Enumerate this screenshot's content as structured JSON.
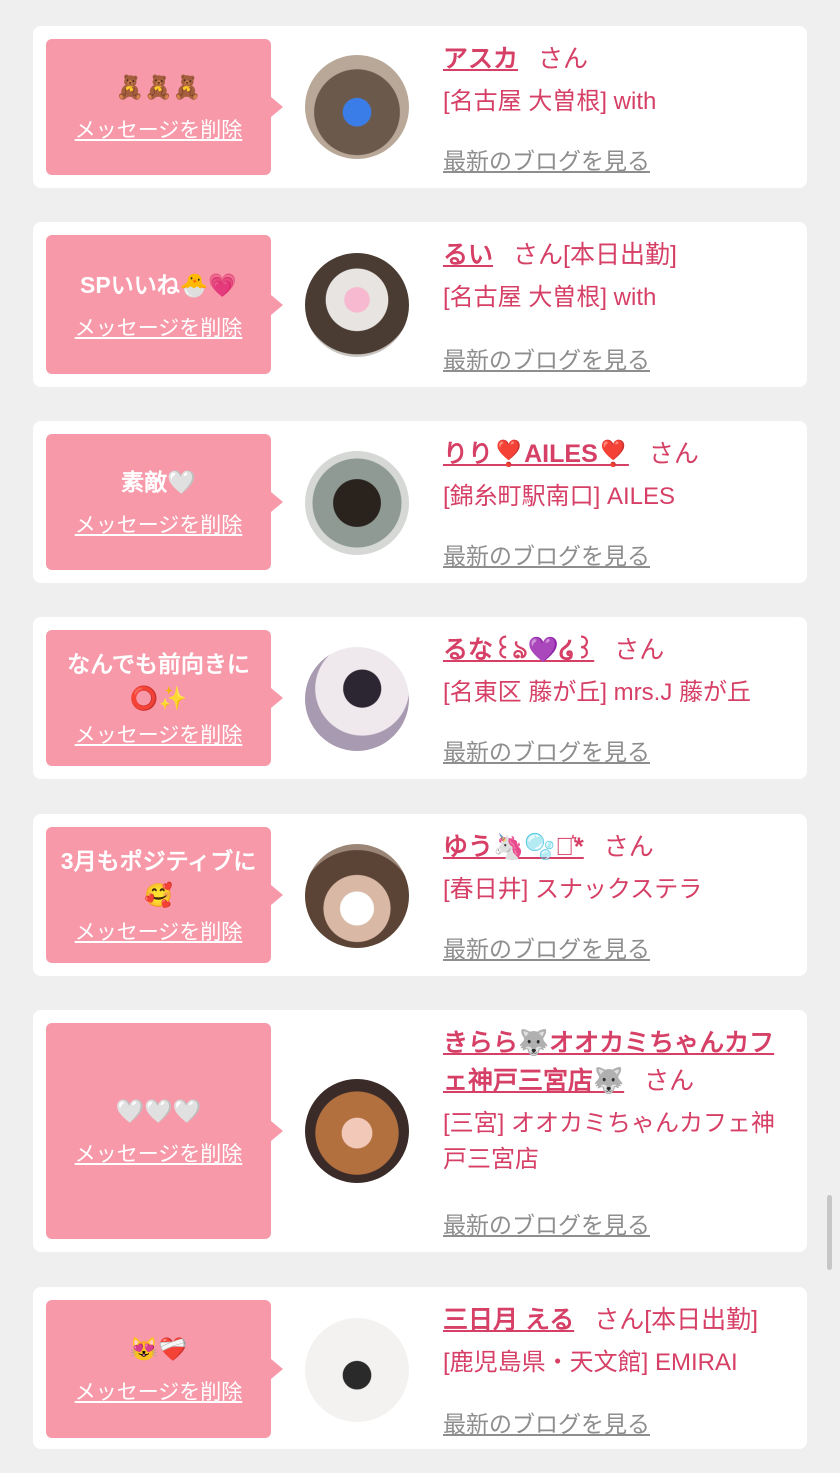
{
  "delete_label": "メッセージを削除",
  "blog_label": "最新のブログを見る",
  "san_label": "さん",
  "accent_color": "#f799a9",
  "name_color": "#d63f66",
  "items": [
    {
      "message": "🧸🧸🧸",
      "name": "アスカ",
      "extra": "",
      "shop": "[名古屋 大曽根] with"
    },
    {
      "message": "SPいいね🐣💗",
      "name": "るい",
      "extra": "[本日出勤]",
      "shop": "[名古屋 大曽根] with"
    },
    {
      "message": "素敵🤍",
      "name": "りり❣️AILES❣️",
      "extra": "",
      "shop": "[錦糸町駅南口] AILES"
    },
    {
      "message": "なんでも前向きに⭕✨",
      "name": "るな꒰ঌ💜໒꒱",
      "extra": "",
      "shop": "[名東区 藤が丘] mrs.J 藤が丘"
    },
    {
      "message": "3月もポジティブに🥰",
      "name": "ゆう🦄🫧⋆͛*",
      "extra": "",
      "shop": "[春日井] スナックステラ"
    },
    {
      "message": "🤍🤍🤍",
      "name": "きらら🐺オオカミちゃんカフェ神戸三宮店🐺",
      "extra": "",
      "shop": "[三宮] オオカミちゃんカフェ神戸三宮店"
    },
    {
      "message": "😻❤️‍🩹",
      "name": "三日月 える",
      "extra": "[本日出勤]",
      "shop": "[鹿児島県・天文館] EMIRAI"
    }
  ]
}
